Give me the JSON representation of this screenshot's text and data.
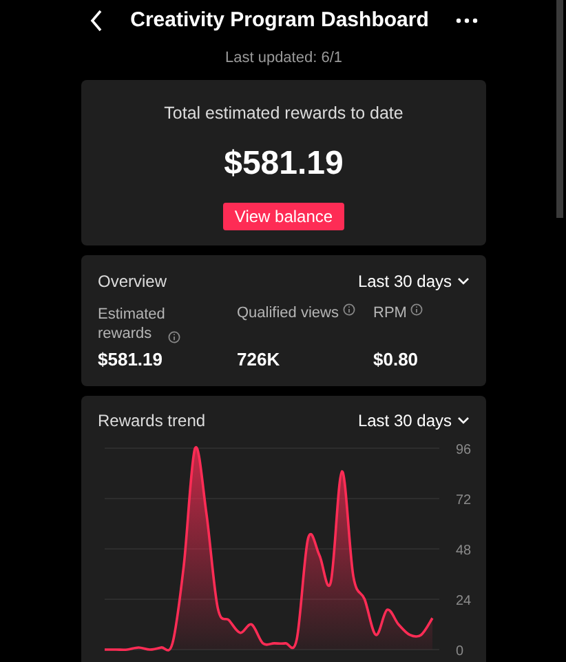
{
  "header": {
    "title": "Creativity Program Dashboard",
    "subtitle": "Last updated: 6/1"
  },
  "total_card": {
    "label": "Total estimated rewards to date",
    "amount": "$581.19",
    "button": "View balance"
  },
  "overview": {
    "title": "Overview",
    "period": "Last 30 days",
    "metrics": [
      {
        "label": "Estimated rewards",
        "value": "$581.19"
      },
      {
        "label": "Qualified views",
        "value": "726K"
      },
      {
        "label": "RPM",
        "value": "$0.80"
      }
    ]
  },
  "rewards_trend": {
    "title": "Rewards trend",
    "period": "Last 30 days",
    "chart_data": {
      "type": "area",
      "grid": true,
      "ylim": [
        0,
        96
      ],
      "yticks": [
        0,
        24,
        48,
        72,
        96
      ],
      "series": [
        {
          "color": "#fe2c55",
          "values": [
            0,
            0,
            0,
            1,
            0,
            1,
            3,
            40,
            96,
            65,
            20,
            14,
            8,
            12,
            3,
            3,
            3,
            5,
            53,
            45,
            32,
            85,
            35,
            24,
            7,
            19,
            12,
            7,
            7,
            15
          ]
        }
      ]
    }
  }
}
